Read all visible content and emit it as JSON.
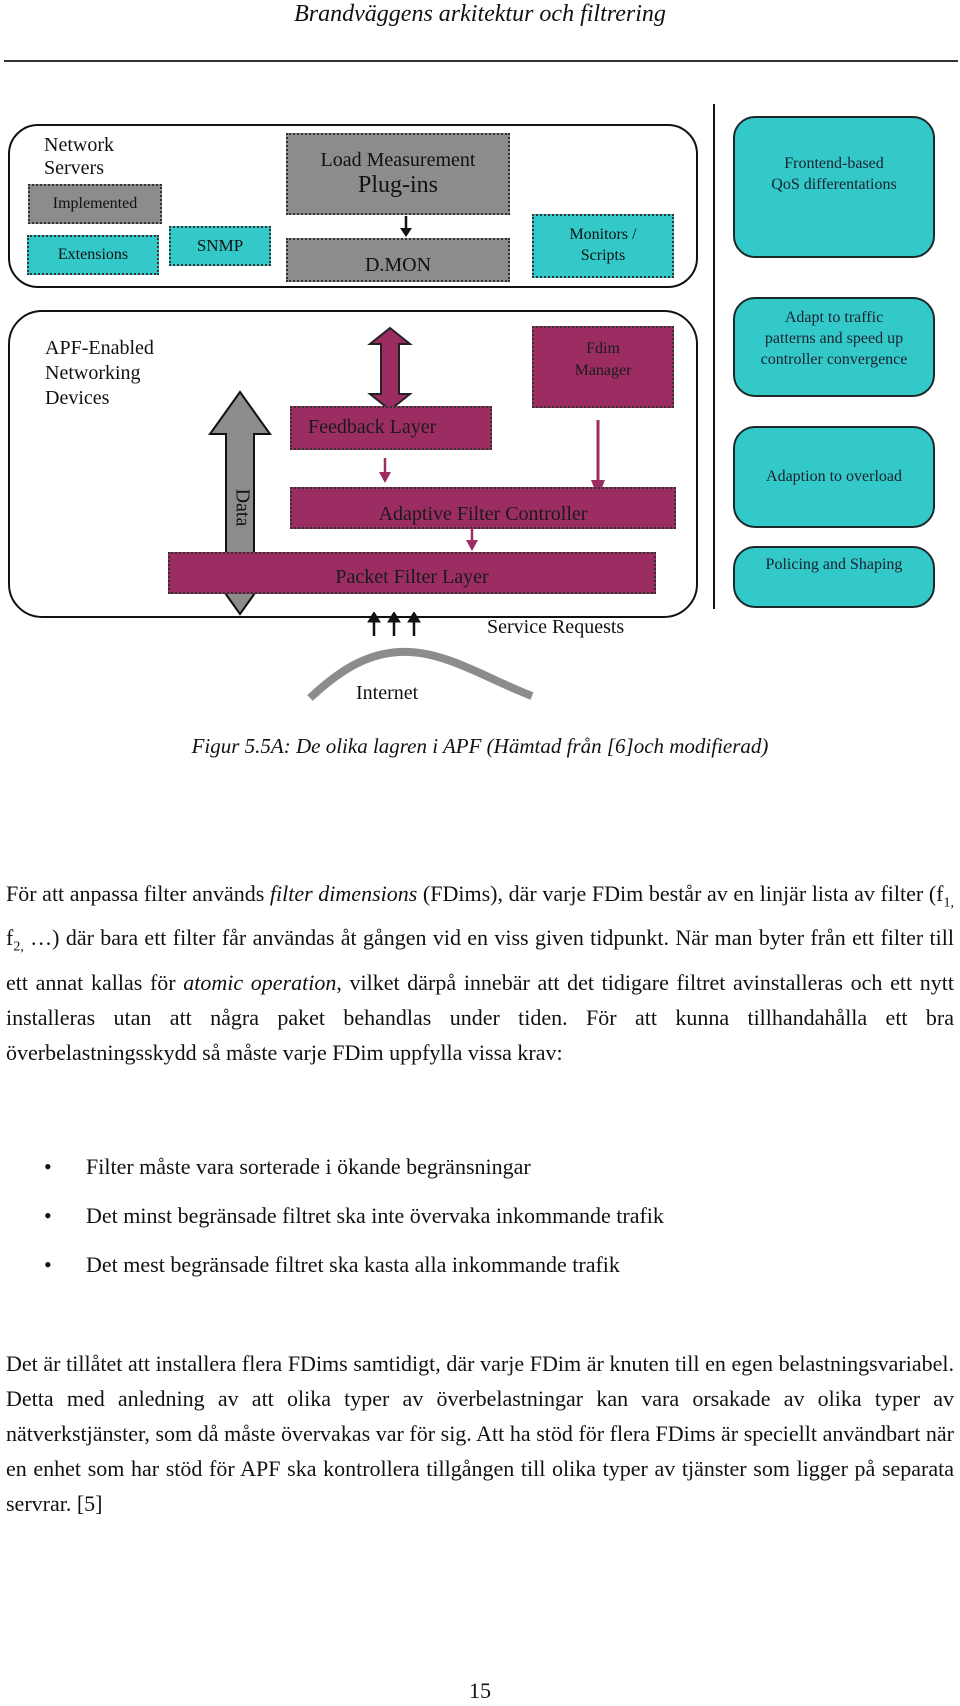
{
  "header": {
    "title": "Brandväggens arkitektur och filtrering"
  },
  "diagram": {
    "colors": {
      "gray": "#8c8c8c",
      "cyan": "#33c9c9",
      "magenta": "#9b2d62"
    },
    "servers_panel": {
      "title_line1": "Network",
      "title_line2": "Servers",
      "implemented": "Implemented",
      "extensions": "Extensions",
      "snmp": "SNMP",
      "load_line1": "Load Measurement",
      "load_line2": "Plug-ins",
      "dmon": "D.MON",
      "monitors_line1": "Monitors /",
      "monitors_line2": "Scripts"
    },
    "devices_panel": {
      "title_line1": "APF-Enabled",
      "title_line2": "Networking",
      "title_line3": "Devices",
      "data_arrow": "Data",
      "feedback_layer": "Feedback Layer",
      "fdim_line1": "Fdim",
      "fdim_line2": "Manager",
      "adaptive_controller": "Adaptive Filter Controller",
      "packet_filter": "Packet Filter Layer"
    },
    "right_boxes": [
      {
        "line1": "Frontend-based",
        "line2": "QoS differentations",
        "line3": ""
      },
      {
        "line1": "Adapt to traffic",
        "line2": "patterns and speed up",
        "line3": "controller convergence"
      },
      {
        "line1": "Adaption to overload",
        "line2": "",
        "line3": ""
      },
      {
        "line1": "Policing and Shaping",
        "line2": "",
        "line3": ""
      }
    ],
    "service_requests": "Service Requests",
    "internet": "Internet"
  },
  "caption": "Figur 5.5A: De olika lagren i APF (Hämtad från [6]och modifierad)",
  "paragraph1": {
    "p1": "För att anpassa filter används ",
    "p1_italic": "filter dimensions",
    "p2": " (FDims), där varje FDim består av en linjär lista av filter (f",
    "sub1": "1,",
    "p3": " f",
    "sub2": "2,",
    "p4": " …) där bara ett filter får användas åt gången vid en viss given tidpunkt. När man byter från ett filter till ett annat kallas för ",
    "p4_italic": "atomic operation",
    "p5": ", vilket därpå innebär att det tidigare filtret avinstalleras och ett nytt installeras utan att några paket behandlas under tiden. För att kunna tillhandahålla ett bra överbelastningsskydd så måste varje FDim uppfylla vissa krav:"
  },
  "bullets": [
    "Filter måste vara sorterade i ökande begränsningar",
    "Det minst begränsade filtret ska inte övervaka inkommande trafik",
    "Det mest begränsade filtret ska kasta alla inkommande trafik"
  ],
  "bullet_glyph": "•",
  "paragraph2": "Det är tillåtet att installera flera FDims samtidigt, där varje FDim är knuten till en egen belastningsvariabel. Detta med anledning av att olika typer av överbelastningar kan vara orsakade av olika typer av nätverkstjänster, som då måste övervakas var för sig. Att ha stöd för flera FDims är speciellt användbart när en enhet som har stöd för APF ska kontrollera tillgången till olika typer av tjänster som ligger på separata servrar. [5]",
  "page_number": "15"
}
